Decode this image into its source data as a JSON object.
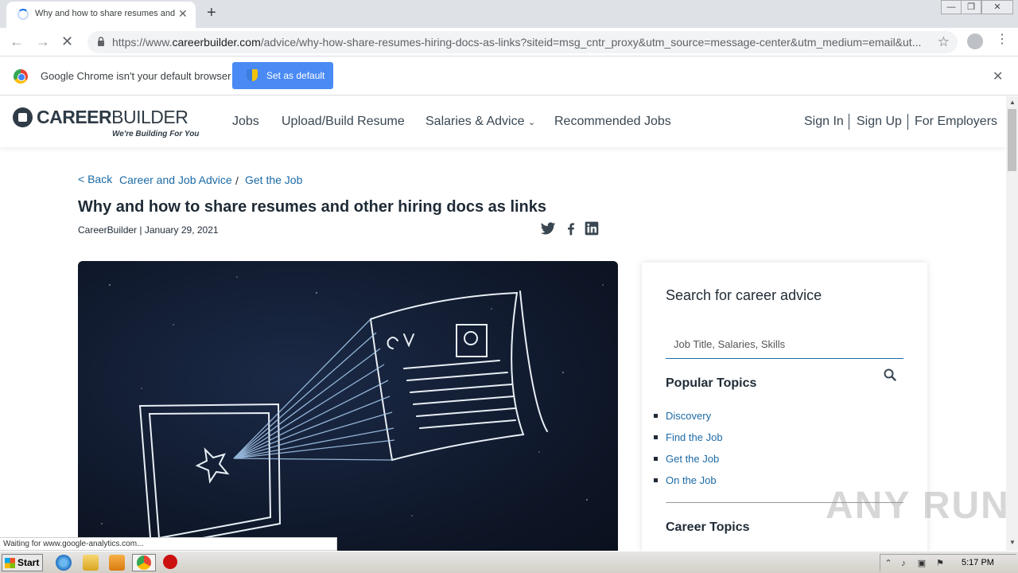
{
  "browser": {
    "tab_title": "Why and how to share resumes and",
    "tab_close": "✕",
    "new_tab": "+",
    "url_prefix": "https://www.",
    "url_host": "careerbuilder.com",
    "url_path": "/advice/why-how-share-resumes-hiring-docs-as-links?siteid=msg_cntr_proxy&utm_source=message-center&utm_medium=email&ut...",
    "infobar_text": "Google Chrome isn't your default browser",
    "set_default_label": "Set as default",
    "status_text": "Waiting for www.google-analytics.com..."
  },
  "site": {
    "logo_bold": "CAREER",
    "logo_light": "BUILDER",
    "tagline": "We're Building For You",
    "nav": {
      "jobs": "Jobs",
      "upload": "Upload/Build Resume",
      "salaries": "Salaries & Advice",
      "recommended": "Recommended Jobs",
      "sign_in": "Sign In",
      "sign_up": "Sign Up",
      "employers": "For Employers"
    }
  },
  "article": {
    "back": "< Back",
    "crumb1": "Career and Job Advice",
    "crumb_sep": "/",
    "crumb2": "Get the Job",
    "title": "Why and how to share resumes and other hiring docs as links",
    "byline": "CareerBuilder | January 29, 2021"
  },
  "sidebar": {
    "search_heading": "Search for career advice",
    "search_placeholder": "Job Title, Salaries, Skills",
    "popular_heading": "Popular Topics",
    "popular": [
      "Discovery",
      "Find the Job",
      "Get the Job",
      "On the Job"
    ],
    "career_heading": "Career Topics"
  },
  "watermark": "ANY RUN",
  "taskbar": {
    "start": "Start",
    "clock": "5:17 PM"
  }
}
